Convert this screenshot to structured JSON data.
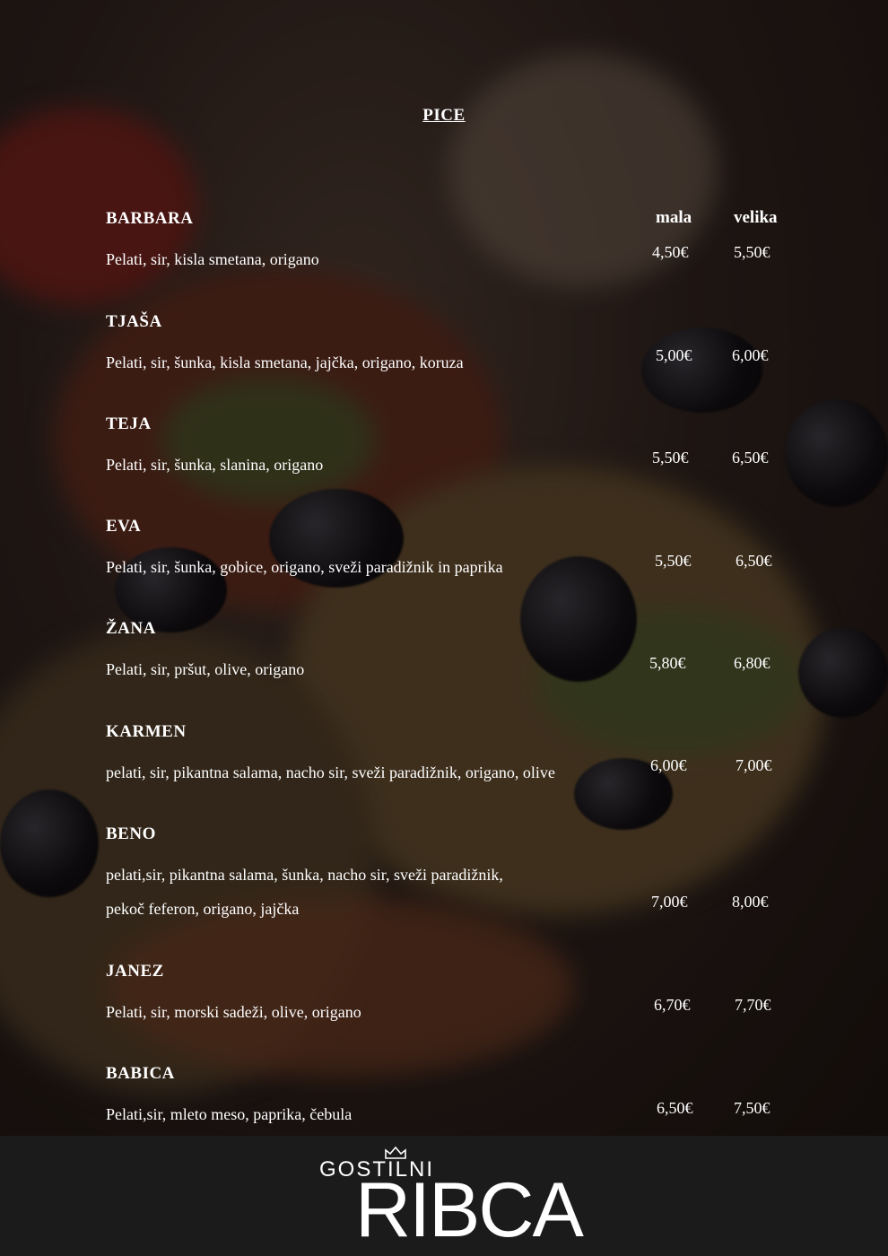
{
  "menu": {
    "title": "PICE",
    "col_small": "mala",
    "col_large": "velika",
    "items": [
      {
        "name": "BARBARA",
        "desc": "Pelati, sir, kisla smetana, origano",
        "small": "4,50€",
        "large": "5,50€"
      },
      {
        "name": "TJAŠA",
        "desc": "Pelati, sir, šunka, kisla smetana, jajčka, origano, koruza",
        "small": "5,00€",
        "large": "6,00€"
      },
      {
        "name": "TEJA",
        "desc": "Pelati, sir, šunka, slanina, origano",
        "small": "5,50€",
        "large": "6,50€"
      },
      {
        "name": "EVA",
        "desc": "Pelati, sir, šunka, gobice, origano, sveži paradižnik in paprika",
        "small": "5,50€",
        "large": "6,50€"
      },
      {
        "name": "ŽANA",
        "desc": "Pelati, sir, pršut, olive, origano",
        "small": "5,80€",
        "large": "6,80€"
      },
      {
        "name": "KARMEN",
        "desc": "pelati, sir, pikantna salama, nacho sir, sveži paradižnik, origano, olive",
        "small": "6,00€",
        "large": "7,00€"
      },
      {
        "name": "BENO",
        "desc": "pelati,sir, pikantna salama, šunka, nacho sir, sveži paradižnik,",
        "desc2": "pekoč feferon, origano, jajčka",
        "small": "7,00€",
        "large": "8,00€"
      },
      {
        "name": "JANEZ",
        "desc": "Pelati, sir, morski sadeži, olive, origano",
        "small": "6,70€",
        "large": "7,70€"
      },
      {
        "name": "BABICA",
        "desc": "Pelati,sir, mleto meso, paprika, čebula",
        "small": "6,50€",
        "large": "7,50€"
      }
    ]
  },
  "footer": {
    "logo_top": "GOSTILNI",
    "logo_bottom": "RIBCA"
  }
}
